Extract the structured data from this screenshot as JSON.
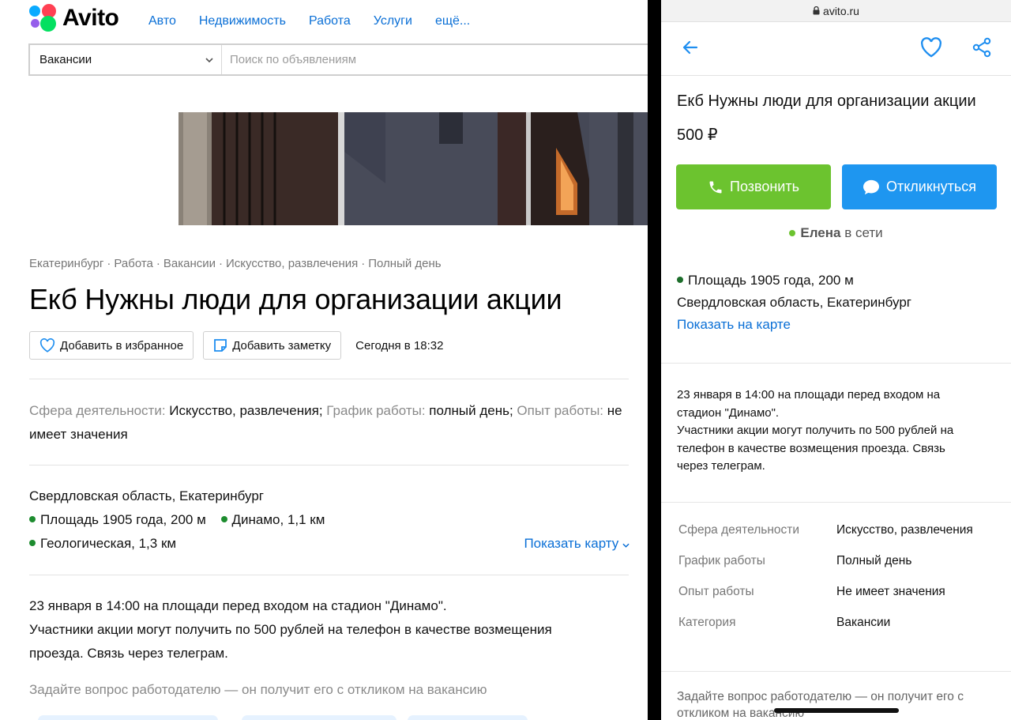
{
  "desktop": {
    "logo_text": "Avito",
    "nav": [
      "Авто",
      "Недвижимость",
      "Работа",
      "Услуги",
      "ещё..."
    ],
    "search": {
      "category": "Вакансии",
      "placeholder": "Поиск по объявлениям"
    },
    "breadcrumbs": [
      "Екатеринбург",
      "Работа",
      "Вакансии",
      "Искусство, развлечения",
      "Полный день"
    ],
    "breadcrumb_sep": "·",
    "title": "Екб Нужны люди для организации акции",
    "add_favorite": "Добавить в избранное",
    "add_note": "Добавить заметку",
    "date": "Сегодня в 18:32",
    "params": [
      {
        "key": "Сфера деятельности:",
        "value": "Искусство, развлечения;"
      },
      {
        "key": "График работы:",
        "value": "полный день;"
      },
      {
        "key": "Опыт работы:",
        "value": "не имеет значения"
      }
    ],
    "region": "Свердловская область, Екатеринбург",
    "metro": [
      "Площадь 1905 года, 200 м",
      "Динамо, 1,1 км",
      "Геологическая, 1,3 км"
    ],
    "show_map": "Показать карту",
    "description": [
      "23 января в 14:00 на площади перед входом на стадион \"Динамо\".",
      "Участники акции могут получить по 500 рублей на телефон в качестве возмещения",
      "проезда. Связь через телеграм."
    ],
    "ask": "Задайте вопрос работодателю — он получит его с откликом на вакансию"
  },
  "mobile": {
    "url": "avito.ru",
    "title": "Екб Нужны люди для организации акции",
    "price": "500 ₽",
    "call": "Позвонить",
    "reply": "Откликнуться",
    "seller_name": "Елена",
    "seller_status": "в сети",
    "metro": "Площадь 1905 года, 200 м",
    "region": "Свердловская область, Екатеринбург",
    "show_map": "Показать на карте",
    "description": [
      "23 января в 14:00 на площади перед входом на",
      "стадион \"Динамо\".",
      "Участники акции могут получить по 500 рублей на",
      "телефон в качестве возмещения проезда. Связь",
      "через телеграм."
    ],
    "params": [
      {
        "key": "Сфера деятельности",
        "value": "Искусство, развлечения"
      },
      {
        "key": "График работы",
        "value": "Полный день"
      },
      {
        "key": "Опыт работы",
        "value": "Не имеет значения"
      },
      {
        "key": "Категория",
        "value": "Вакансии"
      }
    ],
    "ask": "Задайте вопрос работодателю — он получит его с откликом на вакансию"
  },
  "colors": {
    "link": "#0a6fd6",
    "call_green": "#6cc32f",
    "reply_blue": "#1e96f0",
    "metro_dot": "#1d8c2f"
  }
}
